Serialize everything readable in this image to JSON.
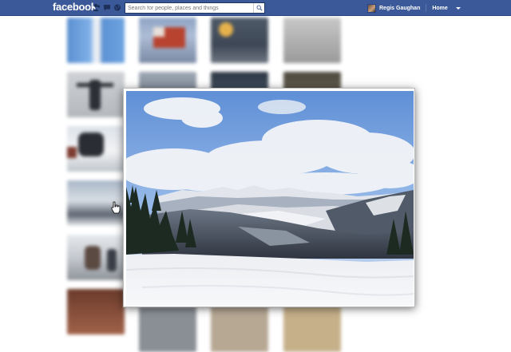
{
  "header": {
    "logo": "facebook",
    "search_placeholder": "Search for people, places and things",
    "user_name": "Regis Gaughan",
    "home_label": "Home"
  },
  "colors": {
    "topbar": "#3b5998",
    "topbar_border": "#29447e",
    "page_bg": "#ffffff"
  },
  "icons": {
    "friend_requests": "friends-icon",
    "messages": "messages-icon",
    "notifications": "globe-icon",
    "search": "search-icon",
    "account_menu": "chevron-down-icon",
    "pointer": "hand-cursor-icon"
  },
  "photo_viewer": {
    "subject": "snowy-mountain-landscape"
  }
}
